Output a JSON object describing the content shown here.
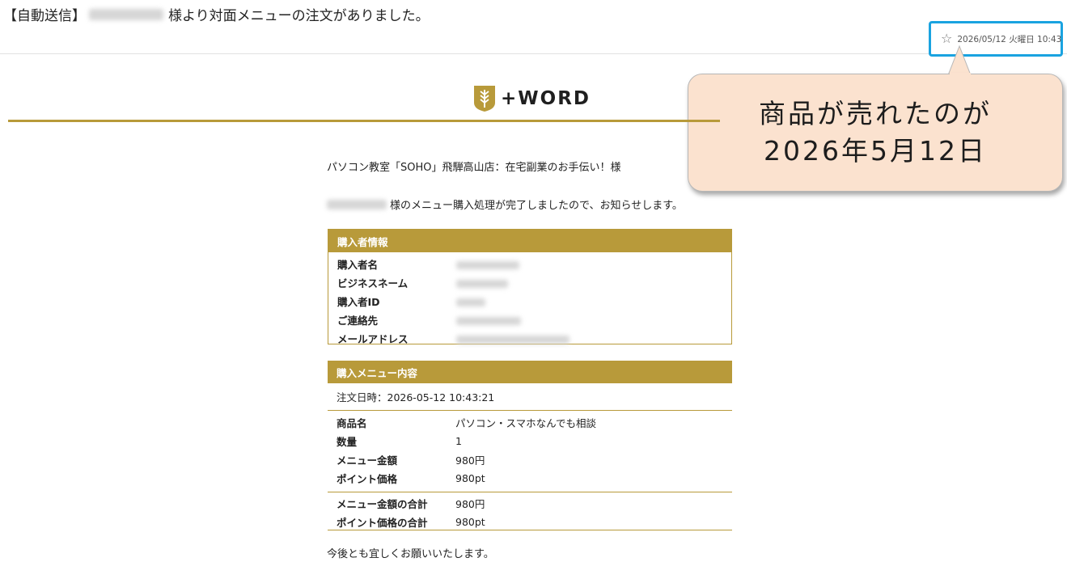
{
  "email": {
    "subject_prefix": "【自動送信】",
    "subject_suffix": "様より対面メニューの注文がありました。",
    "date": "2026/05/12 火曜日 10:43"
  },
  "logo": {
    "text": "+WORD"
  },
  "callout": {
    "line1": "商品が売れたのが",
    "line2": "2026年5月12日"
  },
  "body": {
    "greeting": "パソコン教室「SOHO」飛騨高山店：在宅副業のお手伝い！様",
    "notice_suffix": "様のメニュー購入処理が完了しましたので、お知らせします。",
    "closing": "今後とも宜しくお願いいたします。"
  },
  "buyer": {
    "title": "購入者情報",
    "rows": [
      {
        "label": "購入者名"
      },
      {
        "label": "ビジネスネーム"
      },
      {
        "label": "購入者ID"
      },
      {
        "label": "ご連絡先"
      },
      {
        "label": "メールアドレス"
      }
    ]
  },
  "menu": {
    "title": "購入メニュー内容",
    "order_date": "注文日時：2026-05-12 10:43:21",
    "rows": [
      {
        "label": "商品名",
        "value": "パソコン・スマホなんでも相談"
      },
      {
        "label": "数量",
        "value": "1"
      },
      {
        "label": "メニュー金額",
        "value": "980円"
      },
      {
        "label": "ポイント価格",
        "value": "980pt"
      }
    ],
    "totals": [
      {
        "label": "メニュー金額の合計",
        "value": "980円"
      },
      {
        "label": "ポイント価格の合計",
        "value": "980pt"
      }
    ]
  },
  "colors": {
    "gold": "#b89a3a",
    "highlight": "#1aa3e0",
    "callout_bg": "#fbe2cf"
  }
}
